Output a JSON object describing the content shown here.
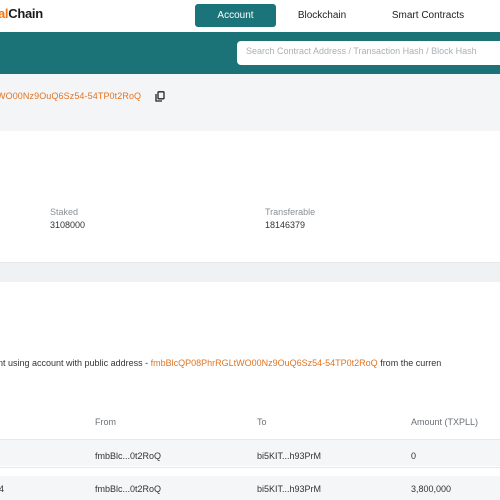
{
  "brand": {
    "part1": "al",
    "part2": "Chain"
  },
  "nav": {
    "account": "Account",
    "blockchain": "Blockchain",
    "smart_contracts": "Smart Contracts"
  },
  "search": {
    "placeholder": "Search Contract Address / Transaction Hash / Block Hash"
  },
  "account": {
    "address_visible": "WO00Nz9OuQ6Sz54-54TP0t2RoQ"
  },
  "balances": {
    "staked_label": "Staked",
    "staked_value": "3108000",
    "transferable_label": "Transferable",
    "transferable_value": "18146379"
  },
  "transactions": {
    "description_prefix": "nt using account with public address - ",
    "description_address": "fmbBlcQP08PhrRGLtWO00Nz9OuQ6Sz54-54TP0t2RoQ",
    "description_suffix": " from the curren",
    "columns": {
      "from": "From",
      "to": "To",
      "amount": "Amount (TXPLL)"
    },
    "rows": [
      {
        "first": "",
        "from": "fmbBlc...0t2RoQ",
        "to": "bi5KIT...h93PrM",
        "amount": "0"
      },
      {
        "first": "4",
        "from": "fmbBlc...0t2RoQ",
        "to": "bi5KIT...h93PrM",
        "amount": "3,800,000"
      }
    ]
  },
  "colors": {
    "teal": "#1b7377",
    "accent_orange": "#e07524"
  },
  "icons": {
    "copy": "copy-icon"
  }
}
